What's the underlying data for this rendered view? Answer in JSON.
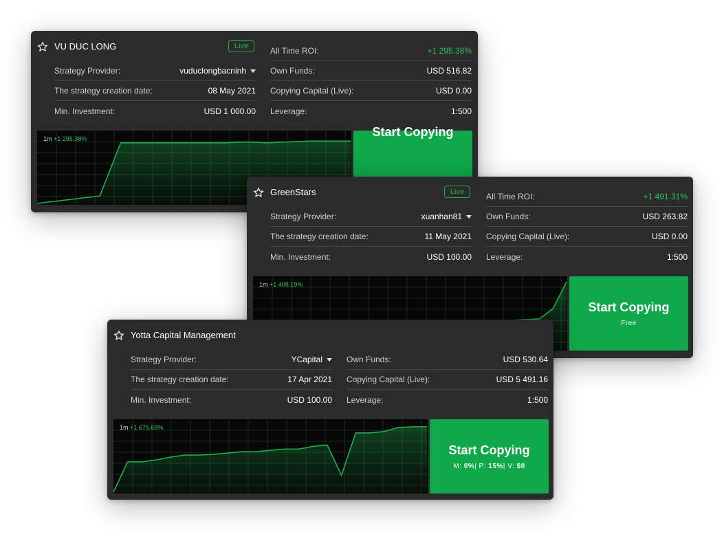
{
  "cards": [
    {
      "name": "VU DUC LONG",
      "badge": "Live",
      "left": [
        {
          "label": "Strategy Provider:",
          "value": "vuduclongbacninh",
          "dropdown": true
        },
        {
          "label": "The strategy creation date:",
          "value": "08 May 2021"
        },
        {
          "label": "Min. Investment:",
          "value": "USD 1 000.00"
        }
      ],
      "right": [
        {
          "label": "All Time ROI:",
          "value": "+1 295.38%"
        },
        {
          "label": "Own Funds:",
          "value": "USD 516.82"
        },
        {
          "label": "Copying Capital (Live):",
          "value": "USD 0.00"
        },
        {
          "label": "Leverage:",
          "value": "1:500"
        }
      ],
      "chart_data": {
        "type": "area",
        "period": "1m",
        "change": "+1 295.38%",
        "values": [
          0,
          3,
          6,
          9,
          72,
          72,
          72,
          72,
          72,
          72,
          73,
          72,
          73,
          74,
          74,
          74
        ],
        "ylim": [
          0,
          80
        ],
        "grid": true,
        "line_color": "#1fae4b"
      },
      "button": {
        "title": "Start Copying"
      }
    },
    {
      "name": "GreenStars",
      "badge": "Live",
      "left": [
        {
          "label": "Strategy Provider:",
          "value": "xuanhan81",
          "dropdown": true
        },
        {
          "label": "The strategy creation date:",
          "value": "11 May 2021"
        },
        {
          "label": "Min. Investment:",
          "value": "USD 100.00"
        }
      ],
      "right": [
        {
          "label": "All Time ROI:",
          "value": "+1 491.31%"
        },
        {
          "label": "Own Funds:",
          "value": "USD 263.82"
        },
        {
          "label": "Copying Capital (Live):",
          "value": "USD 0.00"
        },
        {
          "label": "Leverage:",
          "value": "1:500"
        }
      ],
      "chart_data": {
        "type": "area",
        "period": "1m",
        "change": "+1 408.19%",
        "values": [
          0,
          0,
          0,
          0,
          2,
          5,
          10,
          13,
          28,
          30,
          33,
          36,
          38,
          40,
          40,
          40,
          42,
          42,
          42,
          43,
          44,
          45,
          60,
          100
        ],
        "ylim": [
          0,
          100
        ],
        "grid": true,
        "line_color": "#1fae4b"
      },
      "button": {
        "title": "Start Copying",
        "subtitle": "Free"
      }
    },
    {
      "name": "Yotta Capital Management",
      "left": [
        {
          "label": "Strategy Provider:",
          "value": "YCapital",
          "dropdown": true
        },
        {
          "label": "The strategy creation date:",
          "value": "17 Apr 2021"
        },
        {
          "label": "Min. Investment:",
          "value": "USD 100.00"
        }
      ],
      "right": [
        {
          "label": "Own Funds:",
          "value": "USD 530.64"
        },
        {
          "label": "Copying Capital (Live):",
          "value": "USD 5 491.16"
        },
        {
          "label": "Leverage:",
          "value": "1:500"
        }
      ],
      "chart_data": {
        "type": "area",
        "period": "1m",
        "change": "+1 675.69%",
        "values": [
          0,
          45,
          45,
          48,
          52,
          55,
          55,
          56,
          58,
          60,
          60,
          62,
          64,
          64,
          68,
          70,
          25,
          88,
          88,
          90,
          96,
          97,
          97
        ],
        "ylim": [
          0,
          100
        ],
        "grid": true,
        "line_color": "#1fae4b"
      },
      "button": {
        "title": "Start Copying",
        "stats": [
          {
            "label": "M:",
            "value": "0%"
          },
          {
            "label": "P:",
            "value": "15%"
          },
          {
            "label": "V:",
            "value": "$0"
          }
        ]
      }
    }
  ]
}
